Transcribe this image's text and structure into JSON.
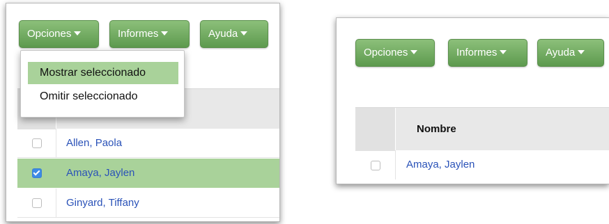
{
  "left_panel": {
    "toolbar": {
      "options_label": "Opciones",
      "reports_label": "Informes",
      "help_label": "Ayuda"
    },
    "dropdown": {
      "items": [
        {
          "label": "Mostrar seleccionado",
          "highlighted": true
        },
        {
          "label": "Omitir seleccionado",
          "highlighted": false
        }
      ]
    },
    "rows": [
      {
        "name": "Allen, Paola",
        "checked": false
      },
      {
        "name": "Amaya, Jaylen",
        "checked": true
      },
      {
        "name": "Ginyard, Tiffany",
        "checked": false
      }
    ]
  },
  "right_panel": {
    "toolbar": {
      "options_label": "Opciones",
      "reports_label": "Informes",
      "help_label": "Ayuda"
    },
    "table": {
      "column_header": "Nombre",
      "rows": [
        {
          "name": "Amaya, Jaylen",
          "checked": false
        }
      ]
    }
  },
  "colors": {
    "button_green": "#6aa85a",
    "selected_row_green": "#a9d29a",
    "link_blue": "#2a52b8",
    "checkbox_blue": "#3d8ae6"
  }
}
